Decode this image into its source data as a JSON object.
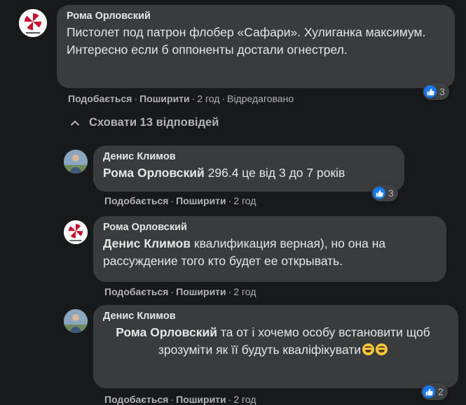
{
  "comment": {
    "author": "Рома Орловский",
    "text": "Пистолет под патрон флобер «Сафари». Хулиганка максимум. Интересно если б оппоненты достали огнестрел.",
    "like_label": "Подобається",
    "share_label": "Поширити",
    "time": "2 год",
    "edited": "Відредаговано",
    "reactions": "3"
  },
  "hide_replies": "Сховати 13 відповідей",
  "replies": [
    {
      "author": "Денис Климов",
      "mention": "Рома Орловский",
      "text": " 296.4 це від 3 до 7 років",
      "like_label": "Подобається",
      "share_label": "Поширити",
      "time": "2 год",
      "reactions": "3"
    },
    {
      "author": "Рома Орловский",
      "mention": "Денис Климов",
      "text": " квалификация верная), но она на рассуждение того кто будет ее открывать.",
      "like_label": "Подобається",
      "share_label": "Поширити",
      "time": "2 год",
      "reactions": ""
    },
    {
      "author": "Денис Климов",
      "mention": "Рома Орловский",
      "text": " та от і хочемо особу встановити щоб зрозуміти як її будуть кваліфікувати",
      "emoji": [
        "rolling-on-floor-laughing-emoji",
        "grinning-sweat-emoji"
      ],
      "like_label": "Подобається",
      "share_label": "Поширити",
      "time": "2 год",
      "reactions": "2"
    }
  ],
  "colors": {
    "background": "#18191a",
    "bubble": "#3a3b3c",
    "text": "#e4e6eb",
    "secondary_text": "#b0b3b8",
    "like_blue": "#1877f2"
  }
}
